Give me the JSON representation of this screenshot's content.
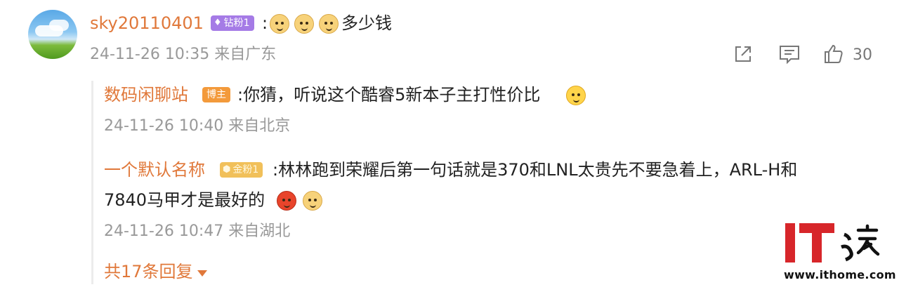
{
  "comment": {
    "username": "sky20110401",
    "badge": "钻粉1",
    "text_prefix": ":",
    "text_suffix": "多少钱",
    "meta": "24-11-26 10:35 来自广东",
    "like_count": "30"
  },
  "replies": [
    {
      "name": "数码闲聊站",
      "badge": "博主",
      "text": ":你猜，听说这个酷睿5新本子主打性价比",
      "meta": "24-11-26 10:40 来自北京"
    },
    {
      "name": "一个默认名称",
      "badge": "金粉1",
      "text_line1": ":林林跑到荣耀后第一句话就是370和LNL太贵先不要急着上，ARL-H和",
      "text_line2": "7840马甲才是最好的",
      "meta": "24-11-26 10:47 来自湖北"
    }
  ],
  "more_replies": "共17条回复",
  "watermark": {
    "logo_text": "IT之家",
    "url": "www.ithome.com"
  },
  "icons": {
    "share": "share-icon",
    "comment": "comment-icon",
    "like": "thumbs-up-icon",
    "diamond": "diamond-icon",
    "caret": "caret-down-icon"
  },
  "colors": {
    "name": "#e0783a",
    "meta": "#999999",
    "diamond_badge": "#a57be6",
    "blogger_badge": "#f39a3b",
    "gold_badge": "#f1c05a",
    "watermark_red": "#d7262a"
  }
}
